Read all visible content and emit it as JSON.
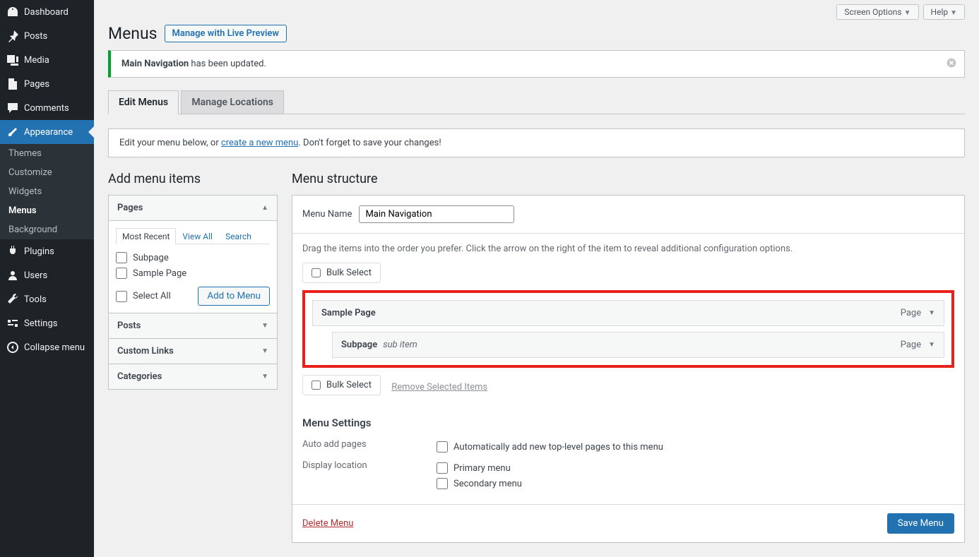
{
  "top": {
    "screen_options": "Screen Options",
    "help": "Help"
  },
  "page": {
    "title": "Menus",
    "live_preview": "Manage with Live Preview"
  },
  "notice": {
    "strong": "Main Navigation",
    "rest": " has been updated."
  },
  "tabs": {
    "edit": "Edit Menus",
    "manage": "Manage Locations"
  },
  "info": {
    "before": "Edit your menu below, or ",
    "link": "create a new menu",
    "after": ". Don't forget to save your changes!"
  },
  "sidebar": {
    "dashboard": "Dashboard",
    "posts": "Posts",
    "media": "Media",
    "pages": "Pages",
    "comments": "Comments",
    "appearance": "Appearance",
    "plugins": "Plugins",
    "users": "Users",
    "tools": "Tools",
    "settings": "Settings",
    "collapse": "Collapse menu",
    "sub": {
      "themes": "Themes",
      "customize": "Customize",
      "widgets": "Widgets",
      "menus": "Menus",
      "background": "Background"
    }
  },
  "left_col": {
    "heading": "Add menu items",
    "acc_pages": "Pages",
    "subtabs": {
      "recent": "Most Recent",
      "viewall": "View All",
      "search": "Search"
    },
    "items": {
      "subpage": "Subpage",
      "sample": "Sample Page"
    },
    "select_all": "Select All",
    "add": "Add to Menu",
    "acc_posts": "Posts",
    "acc_links": "Custom Links",
    "acc_cats": "Categories"
  },
  "right_col": {
    "heading": "Menu structure",
    "menu_name_label": "Menu Name",
    "menu_name_value": "Main Navigation",
    "drag_desc": "Drag the items into the order you prefer. Click the arrow on the right of the item to reveal additional configuration options.",
    "bulk": "Bulk Select",
    "remove_selected": "Remove Selected Items",
    "items": [
      {
        "title": "Sample Page",
        "subtitle": "",
        "type": "Page"
      },
      {
        "title": "Subpage",
        "subtitle": "sub item",
        "type": "Page"
      }
    ],
    "settings_heading": "Menu Settings",
    "auto_add_label": "Auto add pages",
    "auto_add_opt": "Automatically add new top-level pages to this menu",
    "display_label": "Display location",
    "loc_primary": "Primary menu",
    "loc_secondary": "Secondary menu",
    "delete": "Delete Menu",
    "save": "Save Menu"
  }
}
